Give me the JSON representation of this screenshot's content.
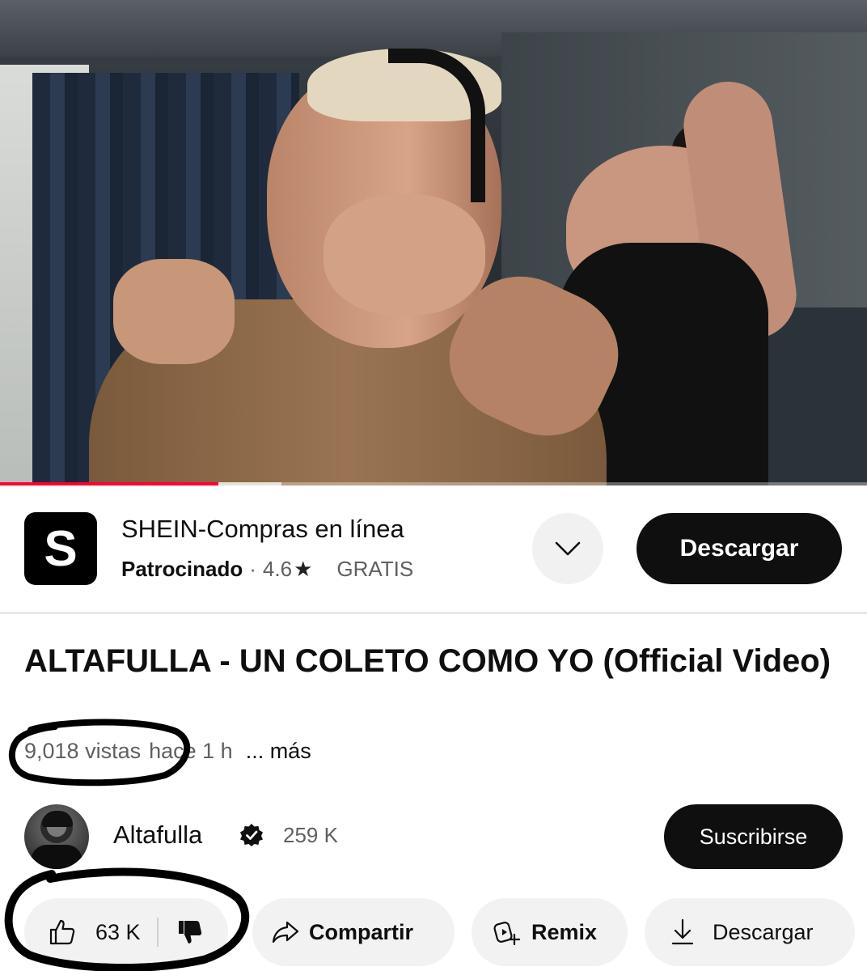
{
  "video": {
    "progress_played": 0.252,
    "progress_buffered": 0.325
  },
  "ad": {
    "logo_letter": "S",
    "title": "SHEIN-Compras en línea",
    "sponsored": "Patrocinado",
    "separator": "·",
    "rating": "4.6",
    "star": "★",
    "price": "GRATIS",
    "cta": "Descargar",
    "expand_icon": "chevron-down-icon"
  },
  "title": "ALTAFULLA - UN COLETO COMO YO (Official Video)",
  "meta": {
    "views": "9,018 vistas",
    "age": "hace 1 h",
    "more": "... más"
  },
  "channel": {
    "name": "Altafulla",
    "subscribers": "259 K",
    "subscribe_label": "Suscribirse"
  },
  "actions": {
    "likes": "63 K",
    "share": "Compartir",
    "remix": "Remix",
    "download": "Descargar"
  },
  "colors": {
    "accent_red": "#ff0033",
    "chip_bg": "#f2f2f2",
    "dark_button": "#0f0f0f"
  }
}
